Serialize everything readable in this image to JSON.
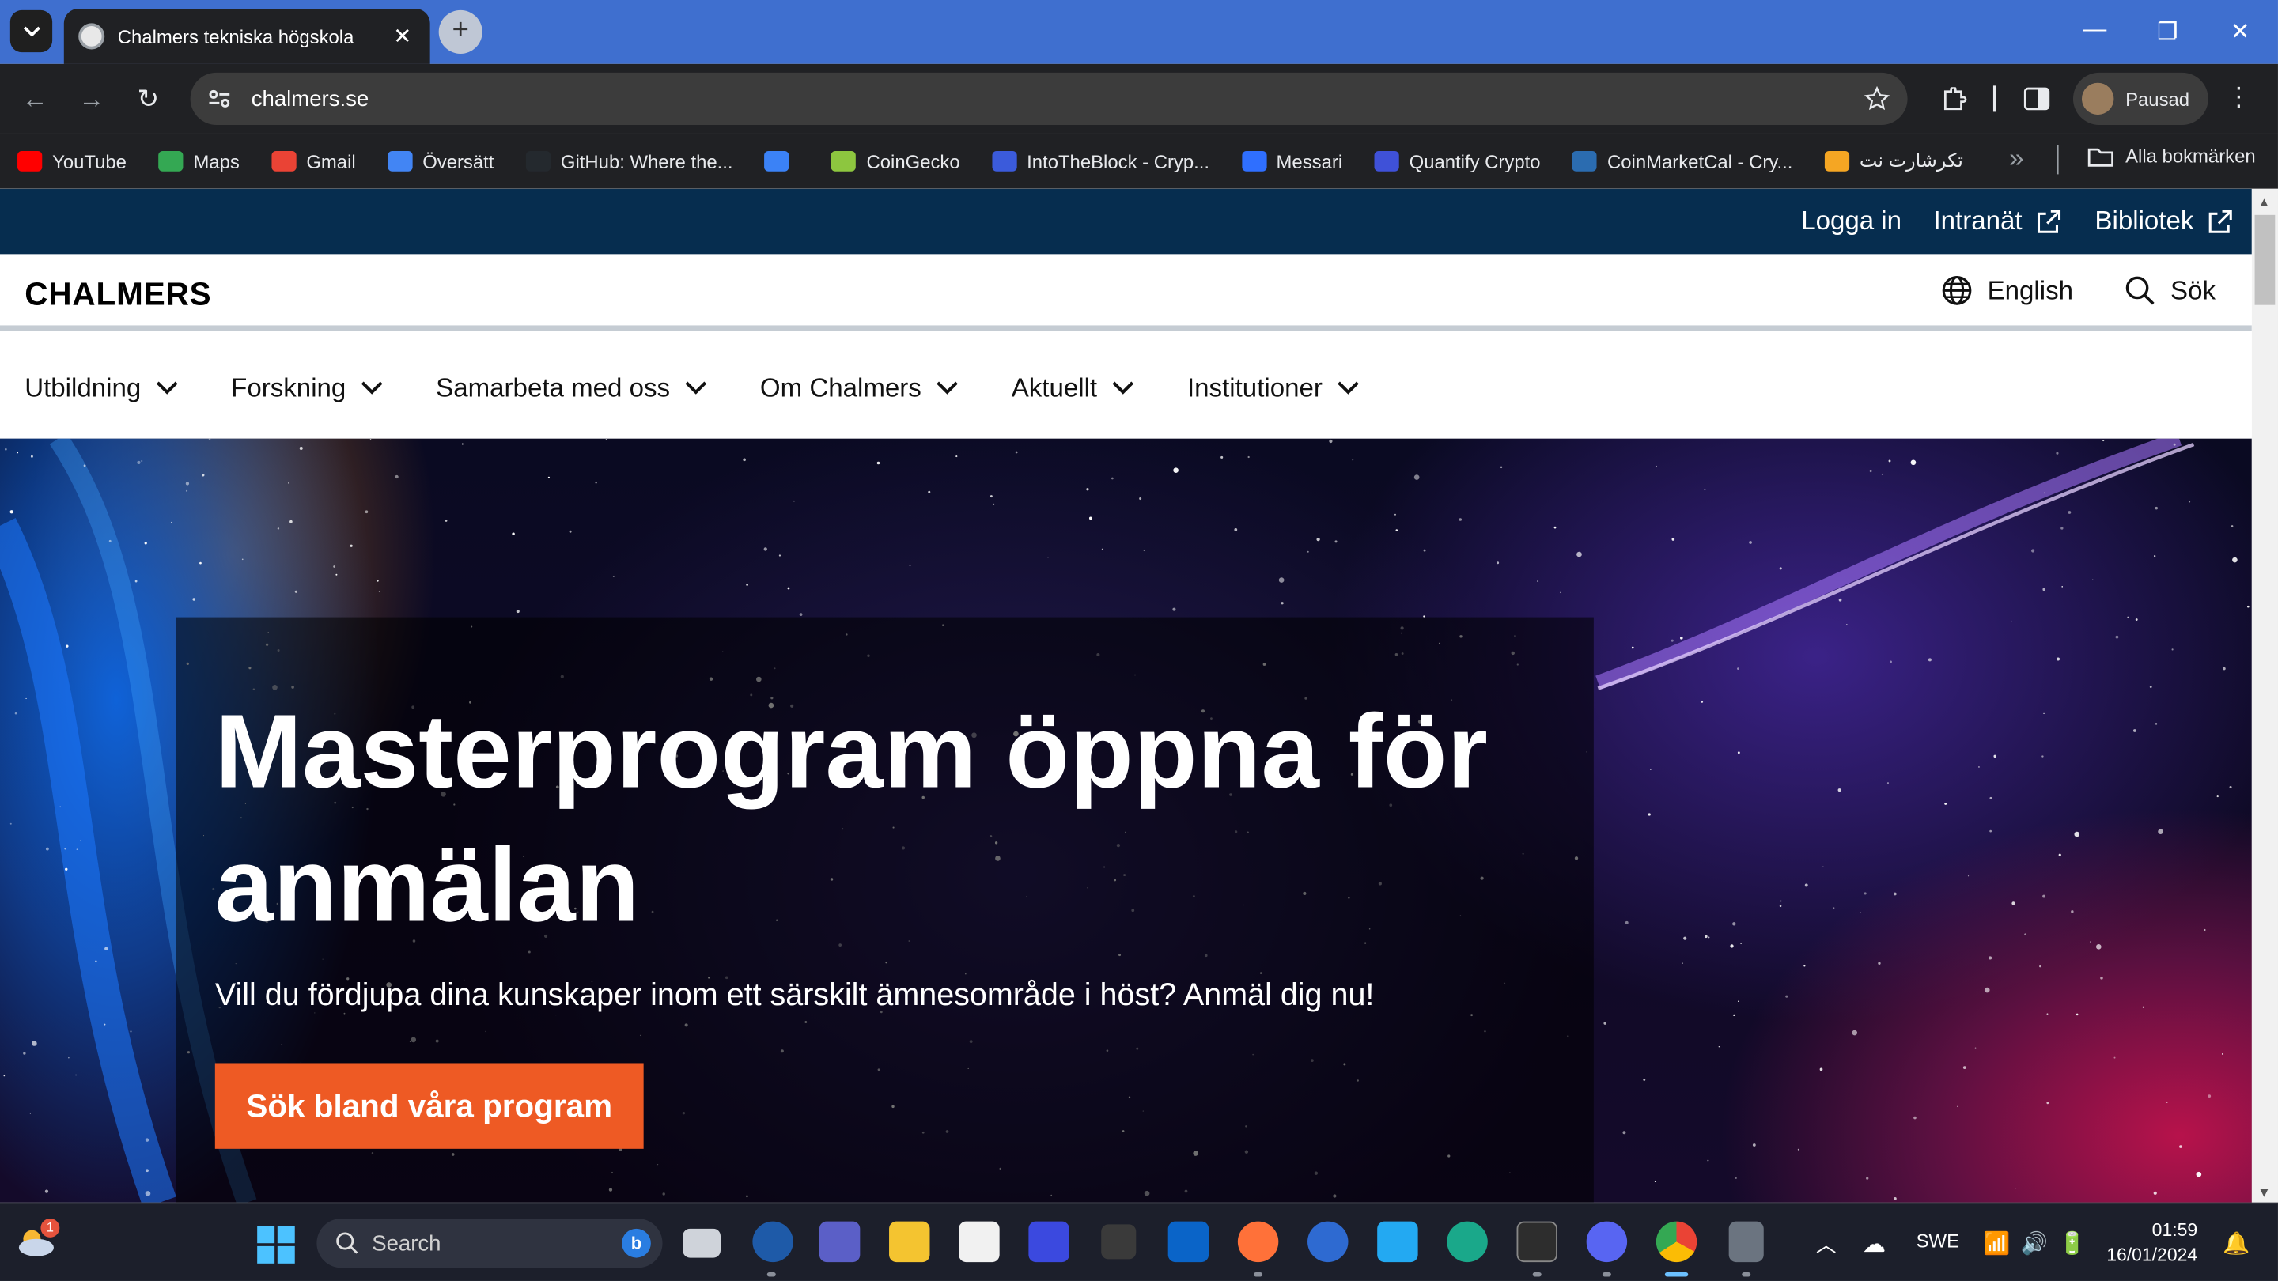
{
  "browser": {
    "tab_title": "Chalmers tekniska högskola",
    "new_tab_symbol": "+",
    "url": "chalmers.se",
    "profile_label": "Pausad",
    "bookmarks": [
      {
        "label": "YouTube",
        "icon": "youtube-icon",
        "color": "#ff0000"
      },
      {
        "label": "Maps",
        "icon": "maps-icon",
        "color": "#34a853"
      },
      {
        "label": "Gmail",
        "icon": "gmail-icon",
        "color": "#ea4335"
      },
      {
        "label": "Översätt",
        "icon": "translate-icon",
        "color": "#4285f4"
      },
      {
        "label": "GitHub: Where the...",
        "icon": "github-icon",
        "color": "#24292e"
      },
      {
        "label": "",
        "icon": "bookmark-blue-icon",
        "color": "#3b82f6"
      },
      {
        "label": "CoinGecko",
        "icon": "coingecko-icon",
        "color": "#8dc63f"
      },
      {
        "label": "IntoTheBlock - Cryp...",
        "icon": "intotheblock-icon",
        "color": "#3b5bdb"
      },
      {
        "label": "Messari",
        "icon": "messari-icon",
        "color": "#2f6fff"
      },
      {
        "label": "Quantify Crypto",
        "icon": "quantify-icon",
        "color": "#3f51d8"
      },
      {
        "label": "CoinMarketCal - Cry...",
        "icon": "coinmarketcal-icon",
        "color": "#2b6cb0"
      },
      {
        "label": "تكرشارت نت",
        "icon": "chart-icon",
        "color": "#f5a623"
      }
    ],
    "more_bookmarks_symbol": "»",
    "all_bookmarks_label": "Alla bokmärken"
  },
  "site": {
    "top_links": [
      {
        "label": "Logga in",
        "external": false
      },
      {
        "label": "Intranät",
        "external": true
      },
      {
        "label": "Bibliotek",
        "external": true
      }
    ],
    "logo_text": "CHALMERS",
    "language_label": "English",
    "search_label": "Sök",
    "menu": [
      "Utbildning",
      "Forskning",
      "Samarbeta med oss",
      "Om Chalmers",
      "Aktuellt",
      "Institutioner"
    ],
    "hero": {
      "title": "Masterprogram öppna för anmälan",
      "subtitle": "Vill du fördjupa dina kunskaper inom ett särskilt ämnesområde i höst? Anmäl dig nu!",
      "cta_label": "Sök bland våra program"
    },
    "colors": {
      "topbar": "#062d4f",
      "cta": "#ee5a24"
    }
  },
  "taskbar": {
    "search_placeholder": "Search",
    "weather_badge": "1",
    "language": "SWE",
    "time": "01:59",
    "date": "16/01/2024"
  }
}
